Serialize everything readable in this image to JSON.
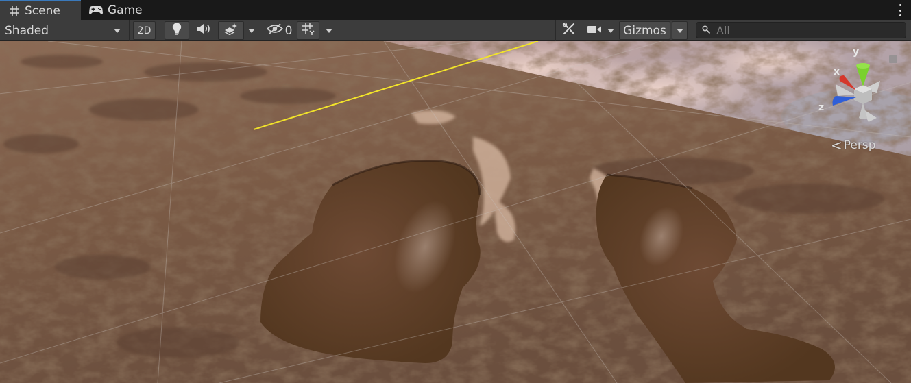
{
  "tabs": {
    "scene_label": "Scene",
    "game_label": "Game"
  },
  "toolbar": {
    "shading_mode": "Shaded",
    "mode_2d_label": "2D",
    "hidden_objects_count": "0",
    "gizmos_label": "Gizmos",
    "search_placeholder": "All"
  },
  "viewport": {
    "projection_label": "Persp",
    "axis_x": "x",
    "axis_y": "y",
    "axis_z": "z"
  },
  "colors": {
    "accent_tab": "#3a79bb",
    "toolbar_bg": "#3c3c3c",
    "gizmo_x": "#d5372b",
    "gizmo_y": "#7ad12e",
    "gizmo_z": "#2f5fd8",
    "selection_line": "#f2e42a"
  },
  "icons": {
    "scene_tab": "hash-grid-icon",
    "game_tab": "gamepad-icon",
    "lighting": "lightbulb-icon",
    "audio": "speaker-icon",
    "effects": "layers-effects-icon",
    "visibility": "eye-slash-icon",
    "grid": "grid-snap-icon",
    "tools": "tools-icon",
    "camera": "camera-icon",
    "search": "search-icon",
    "menu": "kebab-menu-icon"
  }
}
